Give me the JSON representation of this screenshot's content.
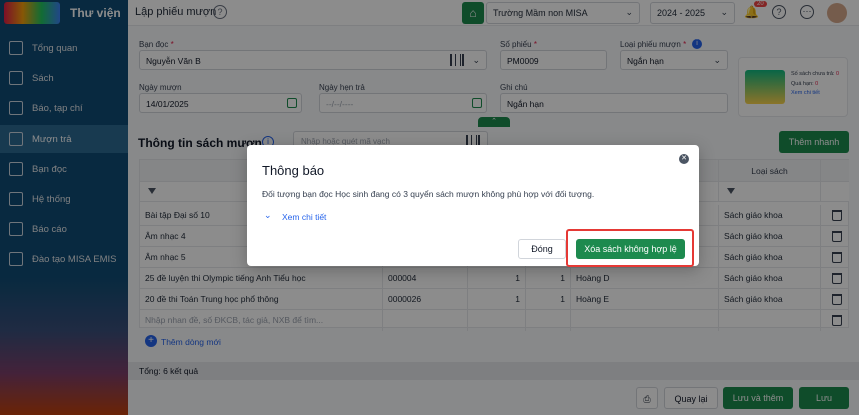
{
  "topbar": {
    "app_title": "Thư viện",
    "page_title": "Lập phiếu mượn",
    "school": "Trường Mầm non MISA",
    "school_year": "2024 - 2025",
    "notification_count": "20"
  },
  "sidebar": {
    "items": [
      {
        "label": "Tổng quan",
        "icon": "dashboard-icon"
      },
      {
        "label": "Sách",
        "icon": "book-icon"
      },
      {
        "label": "Báo, tạp chí",
        "icon": "newspaper-icon"
      },
      {
        "label": "Mượn trả",
        "icon": "borrow-icon",
        "active": true
      },
      {
        "label": "Bạn đọc",
        "icon": "reader-icon"
      },
      {
        "label": "Hệ thống",
        "icon": "settings-icon"
      },
      {
        "label": "Báo cáo",
        "icon": "report-icon"
      },
      {
        "label": "Đào tạo MISA EMIS",
        "icon": "training-icon"
      }
    ]
  },
  "form": {
    "reader_label": "Bạn đọc",
    "reader_value": "Nguyễn Văn B",
    "ticket_no_label": "Số phiếu",
    "ticket_no_value": "PM0009",
    "ticket_type_label": "Loại phiếu mượn",
    "ticket_type_value": "Ngắn hạn",
    "borrow_date_label": "Ngày mượn",
    "borrow_date_value": "14/01/2025",
    "due_date_label": "Ngày hẹn trả",
    "due_date_placeholder": "--/--/----",
    "note_label": "Ghi chú",
    "note_value": "Ngắn hạn"
  },
  "summary_card": {
    "unreturned_label": "Số sách chưa trả:",
    "unreturned_value": "0",
    "overdue_label": "Quá hạn:",
    "overdue_value": "0",
    "detail_link": "Xem chi tiết"
  },
  "books_section": {
    "title": "Thông tin sách mượn",
    "scan_placeholder": "Nhập hoặc quét mã vạch",
    "quick_add_label": "Thêm nhanh",
    "book_type_header": "Loại sách",
    "rows": [
      {
        "title": "Bài tập Đại số 10",
        "code": "",
        "qty": "",
        "qty2": "",
        "author": "",
        "type": "Sách giáo khoa"
      },
      {
        "title": "Âm nhạc 4",
        "code": "",
        "qty": "",
        "qty2": "",
        "author": "",
        "type": "Sách giáo khoa"
      },
      {
        "title": "Âm nhạc 5",
        "code": "",
        "qty": "",
        "qty2": "",
        "author": "",
        "type": "Sách giáo khoa"
      },
      {
        "title": "25 đề luyện thi Olympic tiếng Anh Tiểu học",
        "code": "000004",
        "qty": "1",
        "qty2": "1",
        "author": "Hoàng D",
        "type": "Sách giáo khoa"
      },
      {
        "title": "20 đề thi Toán Trung học phổ thông",
        "code": "0000026",
        "qty": "1",
        "qty2": "1",
        "author": "Hoàng E",
        "type": "Sách giáo khoa"
      }
    ],
    "new_row_placeholder": "Nhập nhan đề, số ĐKCB, tác giả, NXB để tìm...",
    "add_row_label": "Thêm dòng mới",
    "total_label": "Tổng: 6 kết quả"
  },
  "footer": {
    "back_label": "Quay lại",
    "save_add_label": "Lưu và thêm",
    "save_label": "Lưu"
  },
  "dialog": {
    "title": "Thông báo",
    "message": "Đối tượng bạn đọc Học sinh đang có 3 quyển sách mượn không phù hợp với đối tượng.",
    "detail_link": "Xem chi tiết",
    "close_label": "Đóng",
    "remove_label": "Xóa sách không hợp lệ"
  }
}
